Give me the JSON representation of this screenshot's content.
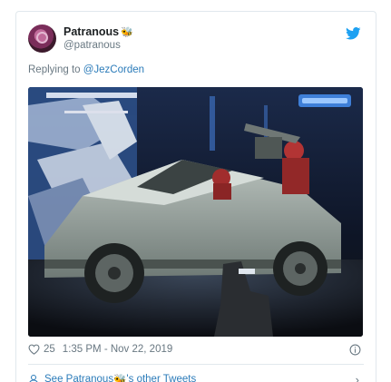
{
  "author": {
    "display_name": "Patranous",
    "emoji": "🐝",
    "username": "@patranous"
  },
  "reply": {
    "prefix": "Replying to ",
    "target": "@JezCorden"
  },
  "media": {
    "alt_subject": "cybertruck-with-halo-spartans"
  },
  "footer": {
    "likes": "25",
    "timestamp": "1:35 PM - Nov 22, 2019"
  },
  "others": {
    "label_prefix": "See Patranous",
    "label_suffix": "'s other Tweets"
  },
  "colors": {
    "link": "#2b7bb9",
    "muted": "#697882",
    "twitter_blue": "#1da1f2"
  }
}
